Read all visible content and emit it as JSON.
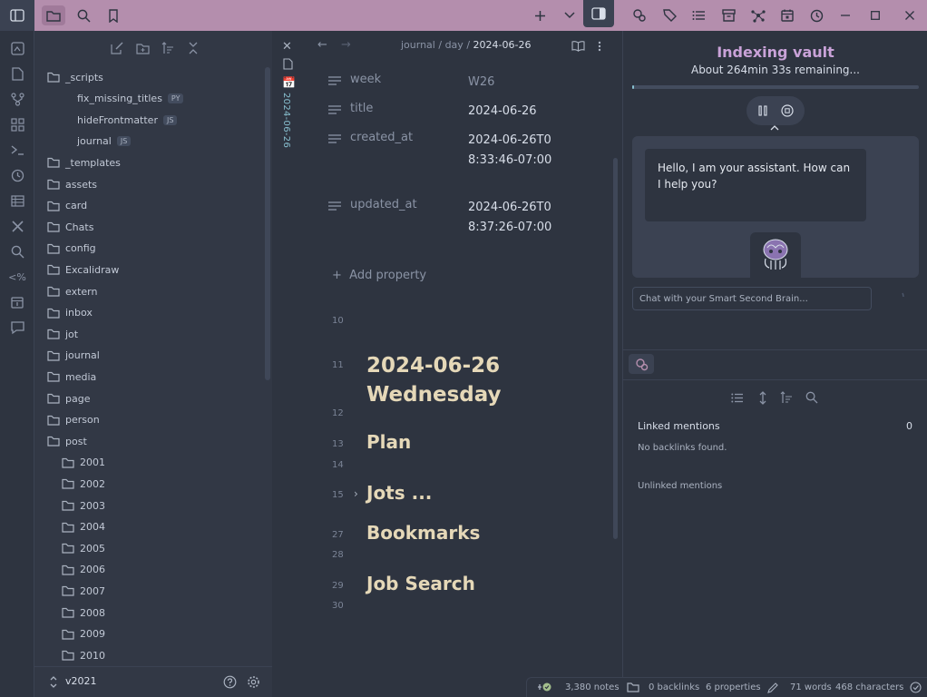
{
  "titlebar": {
    "icons": [
      "sidebar-toggle-icon",
      "folder-icon",
      "search-icon",
      "bookmark-icon",
      "plus-icon",
      "chevron-down-icon",
      "right-sidebar-icon",
      "link-icon",
      "tags-icon",
      "list-icon",
      "archive-icon",
      "graph-icon",
      "calendar-icon",
      "history-icon"
    ],
    "window_controls": [
      "minimize",
      "maximize",
      "close"
    ]
  },
  "ribbon": {
    "icons": [
      "canvas-icon",
      "file-icon",
      "git-icon",
      "blocks-icon",
      "terminal-icon",
      "clock-icon",
      "table-icon",
      "tools-icon",
      "search-icon",
      "percent-code-icon",
      "calendar-icon",
      "chat-icon"
    ]
  },
  "explorer": {
    "tree": [
      {
        "label": "_scripts",
        "type": "folder",
        "depth": 0
      },
      {
        "label": "fix_missing_titles",
        "type": "file",
        "badge": "PY",
        "depth": 1
      },
      {
        "label": "hideFrontmatter",
        "type": "file",
        "badge": "JS",
        "depth": 1
      },
      {
        "label": "journal",
        "type": "file",
        "badge": "JS",
        "depth": 1
      },
      {
        "label": "_templates",
        "type": "folder",
        "depth": 0
      },
      {
        "label": "assets",
        "type": "folder",
        "depth": 0
      },
      {
        "label": "card",
        "type": "folder",
        "depth": 0
      },
      {
        "label": "Chats",
        "type": "folder",
        "depth": 0
      },
      {
        "label": "config",
        "type": "folder",
        "depth": 0
      },
      {
        "label": "Excalidraw",
        "type": "folder",
        "depth": 0
      },
      {
        "label": "extern",
        "type": "folder",
        "depth": 0
      },
      {
        "label": "inbox",
        "type": "folder",
        "depth": 0
      },
      {
        "label": "jot",
        "type": "folder",
        "depth": 0
      },
      {
        "label": "journal",
        "type": "folder",
        "depth": 0
      },
      {
        "label": "media",
        "type": "folder",
        "depth": 0
      },
      {
        "label": "page",
        "type": "folder",
        "depth": 0
      },
      {
        "label": "person",
        "type": "folder",
        "depth": 0
      },
      {
        "label": "post",
        "type": "folder",
        "depth": 0
      },
      {
        "label": "2001",
        "type": "folder",
        "depth": 1
      },
      {
        "label": "2002",
        "type": "folder",
        "depth": 1
      },
      {
        "label": "2003",
        "type": "folder",
        "depth": 1
      },
      {
        "label": "2004",
        "type": "folder",
        "depth": 1
      },
      {
        "label": "2005",
        "type": "folder",
        "depth": 1
      },
      {
        "label": "2006",
        "type": "folder",
        "depth": 1
      },
      {
        "label": "2007",
        "type": "folder",
        "depth": 1
      },
      {
        "label": "2008",
        "type": "folder",
        "depth": 1
      },
      {
        "label": "2009",
        "type": "folder",
        "depth": 1
      },
      {
        "label": "2010",
        "type": "folder",
        "depth": 1
      }
    ],
    "vault_name": "v2021"
  },
  "editor": {
    "tab_title": "2024-06-26",
    "breadcrumb": {
      "part1": "journal",
      "sep": "/",
      "part2": "day",
      "current": "2024-06-26"
    },
    "properties": [
      {
        "key": "week",
        "value": "W26",
        "muted": true
      },
      {
        "key": "title",
        "value": "2024-06-26"
      },
      {
        "key": "created_at",
        "value": "2024-06-26T08:33:46-07:00"
      },
      {
        "key": "updated_at",
        "value": "2024-06-26T08:37:26-07:00"
      }
    ],
    "add_property": "Add property",
    "lines": [
      {
        "num": "10",
        "text": ""
      },
      {
        "num": "11",
        "text": "2024-06-26",
        "text2": "Wednesday",
        "level": 1
      },
      {
        "num": "12",
        "text": ""
      },
      {
        "num": "13",
        "text": "Plan",
        "level": 2
      },
      {
        "num": "14",
        "text": ""
      },
      {
        "num": "15",
        "text": "Jots ...",
        "level": 2,
        "folded": true
      },
      {
        "num": "27",
        "text": "Bookmarks",
        "level": 2
      },
      {
        "num": "28",
        "text": ""
      },
      {
        "num": "29",
        "text": "Job Search",
        "level": 2
      },
      {
        "num": "30",
        "text": ""
      }
    ]
  },
  "smart_brain": {
    "title": "Indexing vault",
    "subtitle": "About 264min 33s remaining...",
    "progress": 0.003,
    "greeting": "Hello, I am your assistant. How can I help you?",
    "input_placeholder": "Chat with your Smart Second Brain..."
  },
  "backlinks": {
    "linked_label": "Linked mentions",
    "linked_count": "0",
    "empty_text": "No backlinks found.",
    "unlinked_label": "Unlinked mentions"
  },
  "statusbar": {
    "notes": "3,380 notes",
    "backlinks": "0 backlinks",
    "properties": "6 properties",
    "words": "71 words",
    "characters": "468 characters"
  },
  "colors": {
    "accent": "#b48ead",
    "heading": "#e5d8b8",
    "link": "#88c0d0",
    "title_purple": "#c9a2d8"
  }
}
